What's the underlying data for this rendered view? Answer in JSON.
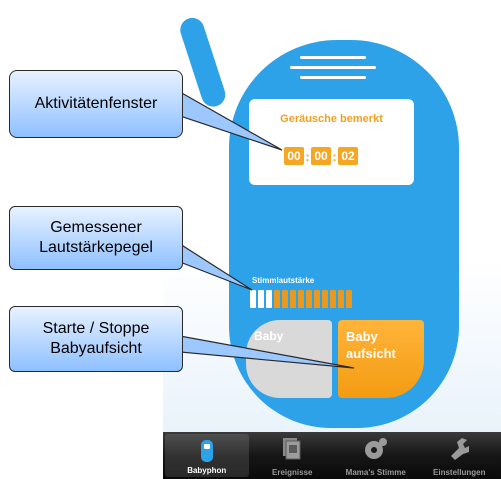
{
  "display": {
    "title": "Geräusche bemerkt",
    "timer": {
      "hours": "00",
      "minutes": "00",
      "seconds": "02",
      "separator": ":"
    }
  },
  "volume": {
    "label": "Stimmlautstärke",
    "segments_total": 13,
    "segments_active": 3
  },
  "buttons": {
    "stop_label": "Baby\naufsicht",
    "start_label": "Baby\naufsicht",
    "stop_visible_text": "Baby",
    "start_line1": "Baby",
    "start_line2": "aufsicht"
  },
  "tabbar": {
    "tabs": [
      {
        "label": "Babyphon",
        "icon": "phone-icon",
        "selected": true
      },
      {
        "label": "Ereignisse",
        "icon": "events-icon",
        "selected": false
      },
      {
        "label": "Mama's Stimme",
        "icon": "voice-icon",
        "selected": false
      },
      {
        "label": "Einstellungen",
        "icon": "settings-icon",
        "selected": false
      }
    ]
  },
  "callouts": {
    "activity_window": "Aktivitätenfenster",
    "volume_level": "Gemessener\nLautstärkepegel",
    "start_stop": "Starte / Stoppe\nBabyaufsicht"
  },
  "colors": {
    "phone_blue": "#2ea2e8",
    "accent_orange": "#f5a623",
    "callout_blue": "#8ec0ff"
  }
}
